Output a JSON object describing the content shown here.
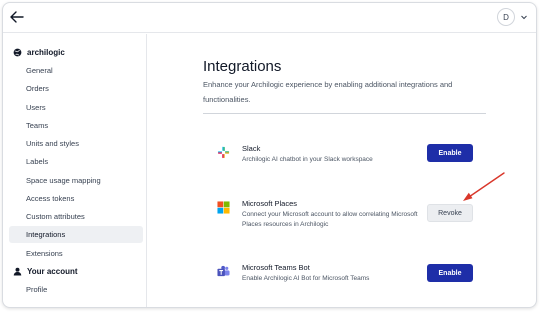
{
  "header": {
    "avatar_initial": "D"
  },
  "sidebar": {
    "org_name": "archilogic",
    "org_items": [
      {
        "label": "General"
      },
      {
        "label": "Orders"
      },
      {
        "label": "Users"
      },
      {
        "label": "Teams"
      },
      {
        "label": "Units and styles"
      },
      {
        "label": "Labels"
      },
      {
        "label": "Space usage mapping"
      },
      {
        "label": "Access tokens"
      },
      {
        "label": "Custom attributes"
      },
      {
        "label": "Integrations",
        "active": true
      },
      {
        "label": "Extensions"
      }
    ],
    "account_title": "Your account",
    "account_items": [
      {
        "label": "Profile"
      }
    ]
  },
  "main": {
    "title": "Integrations",
    "description": "Enhance your Archilogic experience by enabling additional integrations and functionalities.",
    "integrations": [
      {
        "icon": "slack-icon",
        "name": "Slack",
        "description": "Archilogic AI chatbot in your Slack workspace",
        "action": "Enable"
      },
      {
        "icon": "microsoft-icon",
        "name": "Microsoft Places",
        "description": "Connect your Microsoft account to allow correlating Microsoft Places resources in Archilogic",
        "action": "Revoke"
      },
      {
        "icon": "teams-icon",
        "name": "Microsoft Teams Bot",
        "description": "Enable Archilogic AI Bot for Microsoft Teams",
        "action": "Enable"
      }
    ]
  },
  "colors": {
    "primary_button": "#1e2ea8",
    "annotation_arrow": "#d9372b",
    "active_sidebar": "#eef0f3"
  }
}
